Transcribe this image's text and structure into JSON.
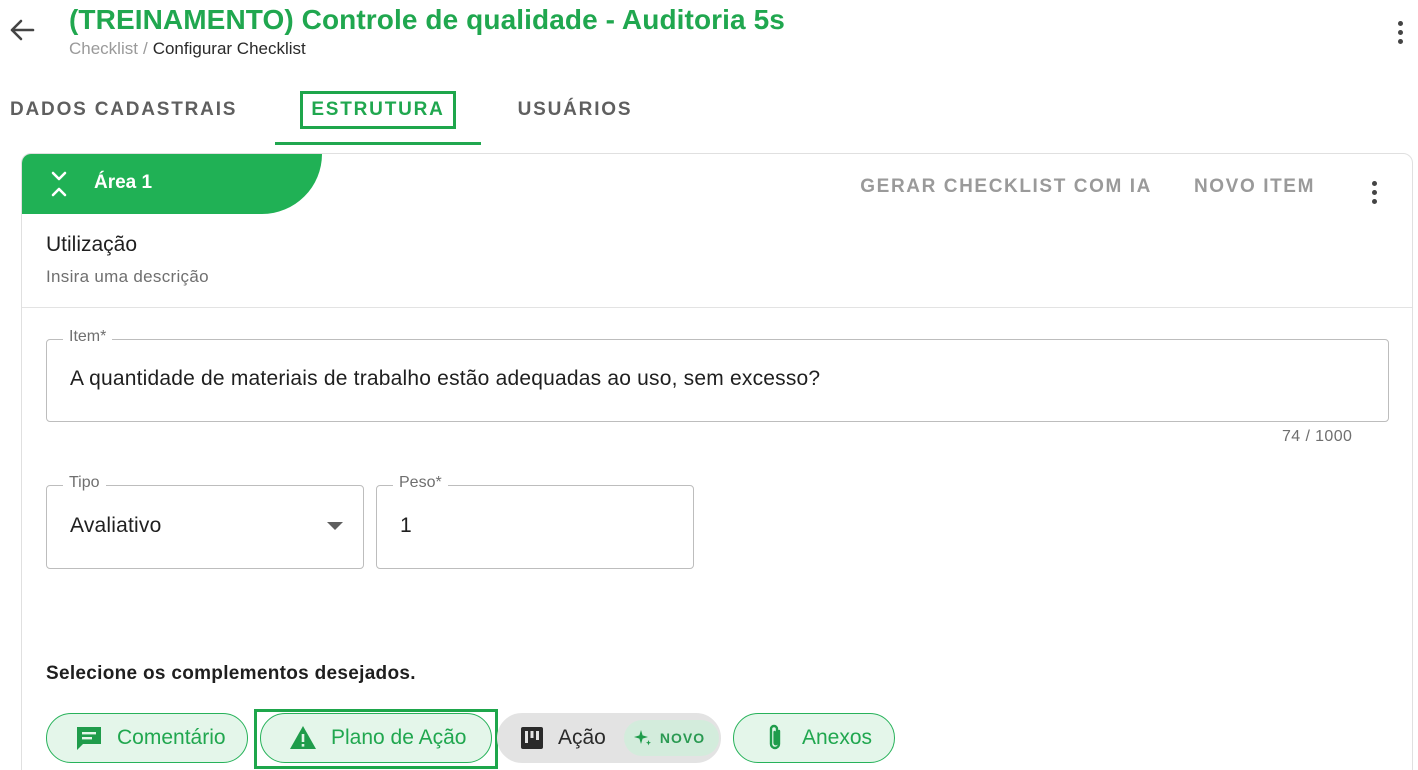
{
  "header": {
    "title": "(TREINAMENTO) Controle de qualidade - Auditoria 5s",
    "breadcrumb": {
      "parent": "Checklist",
      "separator": "/",
      "current": "Configurar Checklist"
    }
  },
  "tabs": [
    {
      "label": "DADOS CADASTRAIS"
    },
    {
      "label": "ESTRUTURA",
      "active": true
    },
    {
      "label": "USUÁRIOS"
    }
  ],
  "area": {
    "title": "Área 1",
    "actions": {
      "generate": "GERAR CHECKLIST COM IA",
      "new_item": "NOVO ITEM"
    }
  },
  "section": {
    "name": "Utilização",
    "description": "Insira uma descrição"
  },
  "item_field": {
    "label": "Item*",
    "value": "A quantidade de materiais de trabalho estão adequadas ao uso, sem excesso?",
    "counter": "74 / 1000"
  },
  "tipo_field": {
    "label": "Tipo",
    "value": "Avaliativo"
  },
  "peso_field": {
    "label": "Peso*",
    "value": "1"
  },
  "complements": {
    "title": "Selecione os complementos desejados.",
    "chips": {
      "comentario": "Comentário",
      "plano": "Plano de Ação",
      "acao": "Ação",
      "novo": "NOVO",
      "anexos": "Anexos"
    }
  },
  "colors": {
    "brand_green": "#20b155",
    "text_green": "#20a74f",
    "chip_bg": "#e4f6ea"
  }
}
